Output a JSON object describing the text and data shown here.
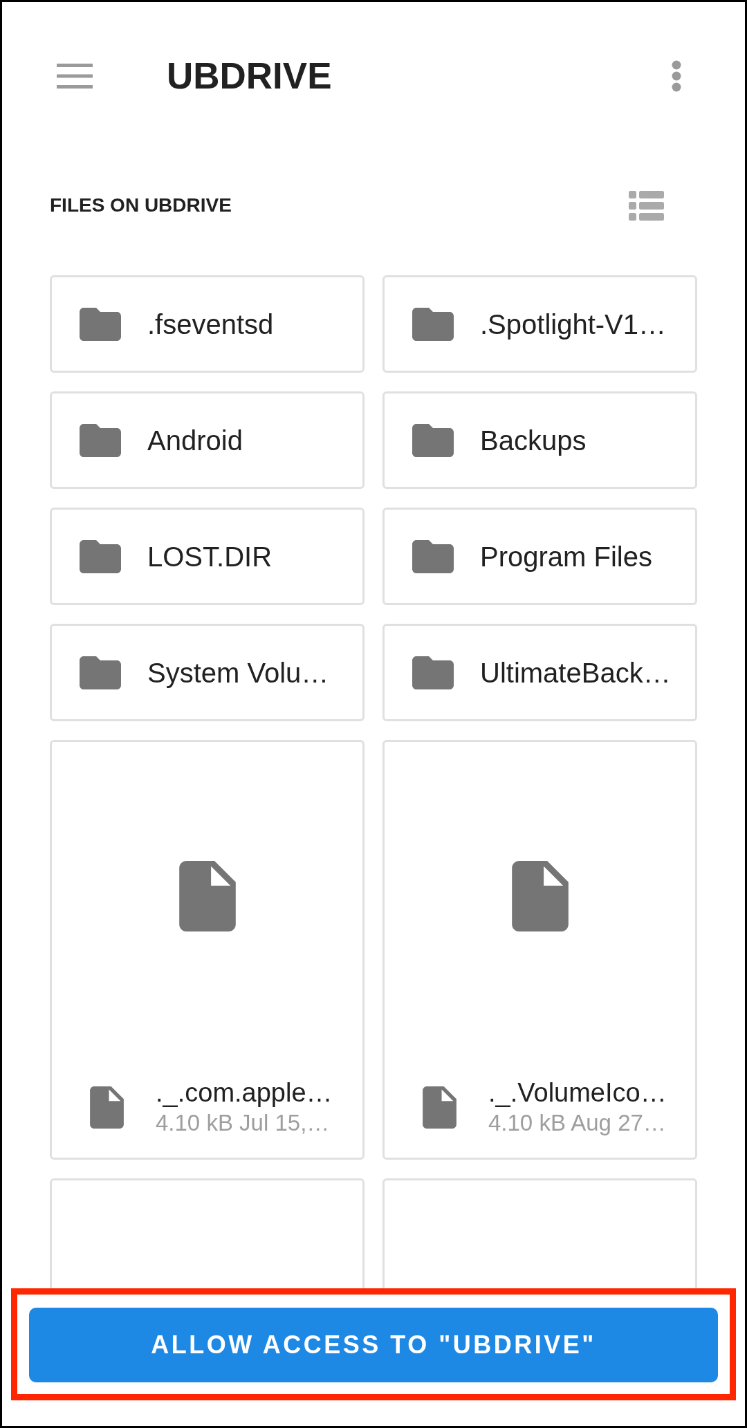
{
  "app_bar": {
    "title": "UBDRIVE"
  },
  "section": {
    "title": "FILES ON UBDRIVE"
  },
  "items": [
    {
      "kind": "folder",
      "name": ".fseventsd"
    },
    {
      "kind": "folder",
      "name": ".Spotlight-V1…"
    },
    {
      "kind": "folder",
      "name": "Android"
    },
    {
      "kind": "folder",
      "name": "Backups"
    },
    {
      "kind": "folder",
      "name": "LOST.DIR"
    },
    {
      "kind": "folder",
      "name": "Program Files"
    },
    {
      "kind": "folder",
      "name": "System Volu…"
    },
    {
      "kind": "folder",
      "name": "UltimateBack…"
    },
    {
      "kind": "file",
      "name": "._.com.apple…",
      "meta": "4.10 kB Jul 15,…"
    },
    {
      "kind": "file",
      "name": "._.VolumeIco…",
      "meta": "4.10 kB Aug 27…"
    },
    {
      "kind": "empty"
    },
    {
      "kind": "empty"
    }
  ],
  "action_button": {
    "label": "ALLOW ACCESS TO \"UBDRIVE\"",
    "highlighted": true
  }
}
